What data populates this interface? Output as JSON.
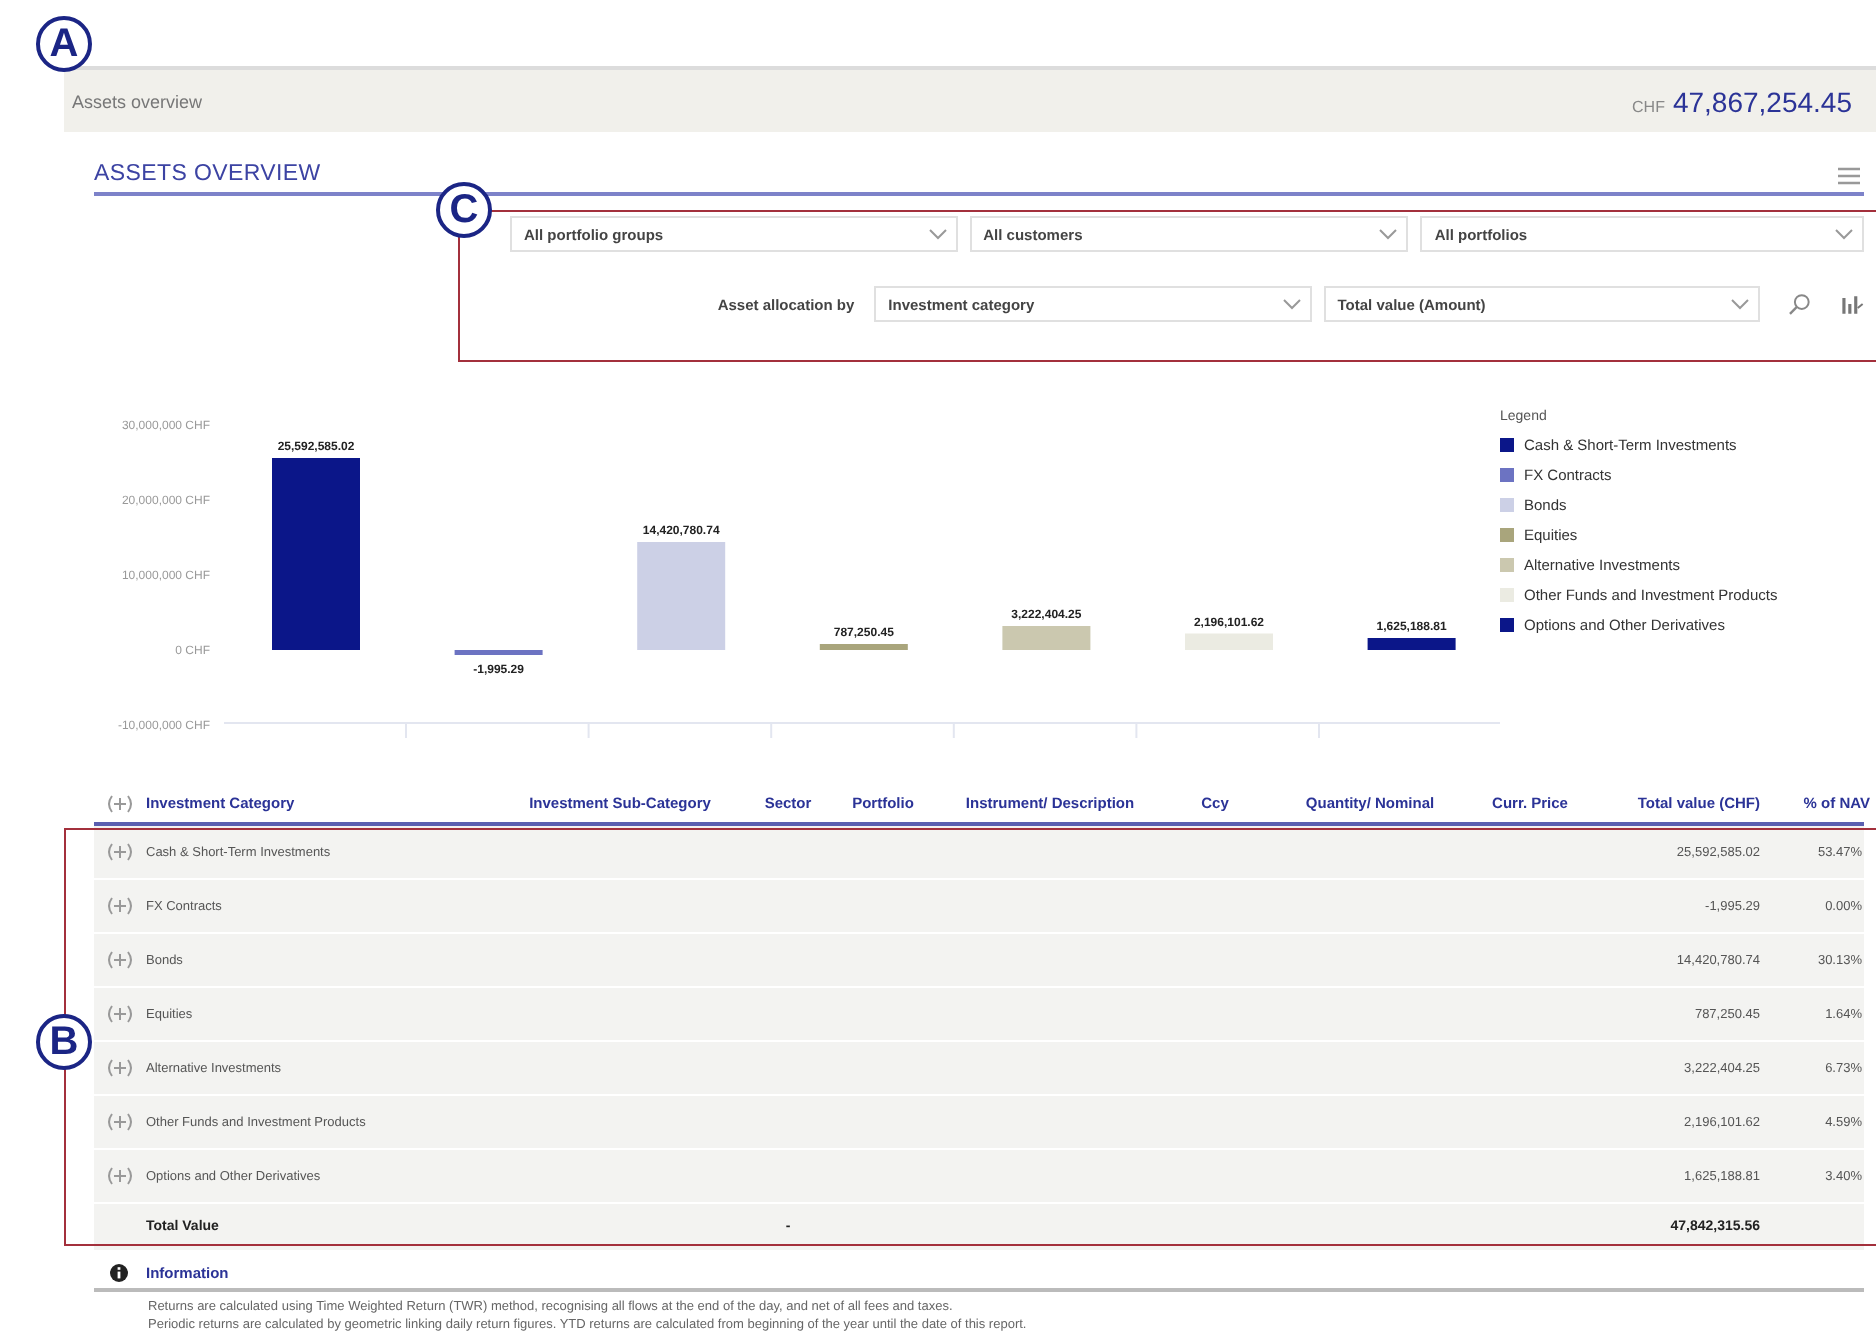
{
  "annotations": [
    {
      "label": "A"
    },
    {
      "label": "B"
    },
    {
      "label": "C"
    }
  ],
  "header": {
    "title": "Assets overview",
    "currency": "CHF",
    "total": "47,867,254.45"
  },
  "section": {
    "title": "ASSETS OVERVIEW"
  },
  "filters": {
    "row_1": [
      {
        "value": "All portfolio groups"
      },
      {
        "value": "All customers"
      },
      {
        "value": "All portfolios"
      }
    ],
    "allocation_label": "Asset allocation by",
    "row_2": [
      {
        "value": "Investment category"
      },
      {
        "value": "Total value (Amount)"
      }
    ]
  },
  "chart": {
    "chart_data": {
      "type": "bar",
      "series": [
        {
          "values": [
            25600000,
            -2000,
            14400000,
            800000,
            3200000,
            2200000,
            1600000
          ]
        }
      ],
      "ylim": [
        -10000000,
        30000000
      ],
      "yticks": [
        {
          "value": 30000000,
          "label": "30,000,000 CHF"
        },
        {
          "value": 20000000,
          "label": "20,000,000 CHF"
        },
        {
          "value": 10000000,
          "label": "10,000,000 CHF"
        },
        {
          "value": 0,
          "label": "0 CHF"
        },
        {
          "value": -10000000,
          "label": "-10,000,000 CHF"
        }
      ],
      "value_labels": [
        "25,592,585.02",
        "-1,995.29",
        "14,420,780.74",
        "787,250.45",
        "3,222,404.25",
        "2,196,101.62",
        "1,625,188.81"
      ]
    }
  },
  "legend": {
    "title": "Legend",
    "items": [
      {
        "label": "Cash & Short-Term Investments",
        "color": "#0b1689"
      },
      {
        "label": "FX Contracts",
        "color": "#6c73c2"
      },
      {
        "label": "Bonds",
        "color": "#ccd0e6"
      },
      {
        "label": "Equities",
        "color": "#a9a57c"
      },
      {
        "label": "Alternative Investments",
        "color": "#cbc8af"
      },
      {
        "label": "Other Funds and Investment Products",
        "color": "#ebebe2"
      },
      {
        "label": "Options and Other Derivatives",
        "color": "#0b1689"
      }
    ]
  },
  "table": {
    "expand_all": {
      "expanded": false
    },
    "columns": [
      "Investment Category",
      "Investment Sub-Category",
      "Sector",
      "Portfolio",
      "Instrument/ Description",
      "Ccy",
      "Quantity/ Nominal",
      "Curr. Price",
      "Total value (CHF)",
      "% of NAV"
    ],
    "rows": [
      {
        "category": "Cash & Short-Term Investments",
        "total": "25,592,585.02",
        "percent": "53.47%",
        "expanded": false
      },
      {
        "category": "FX Contracts",
        "total": "-1,995.29",
        "percent": "0.00%",
        "expanded": false
      },
      {
        "category": "Bonds",
        "total": "14,420,780.74",
        "percent": "30.13%",
        "expanded": false
      },
      {
        "category": "Equities",
        "total": "787,250.45",
        "percent": "1.64%",
        "expanded": false
      },
      {
        "category": "Alternative Investments",
        "total": "3,222,404.25",
        "percent": "6.73%",
        "expanded": false
      },
      {
        "category": "Other Funds and Investment Products",
        "total": "2,196,101.62",
        "percent": "4.59%",
        "expanded": false
      },
      {
        "category": "Options and Other Derivatives",
        "total": "1,625,188.81",
        "percent": "3.40%",
        "expanded": false
      }
    ],
    "total_row": {
      "label": "Total Value",
      "sector": "-",
      "total": "47,842,315.56"
    }
  },
  "information": {
    "title": "Information",
    "lines": [
      "Returns are calculated using Time Weighted Return (TWR) method, recognising all flows at the end of the day, and net of all fees and taxes.",
      "Periodic returns are calculated by geometric linking daily return figures. YTD returns are calculated from beginning of the year until the date of this report."
    ]
  }
}
